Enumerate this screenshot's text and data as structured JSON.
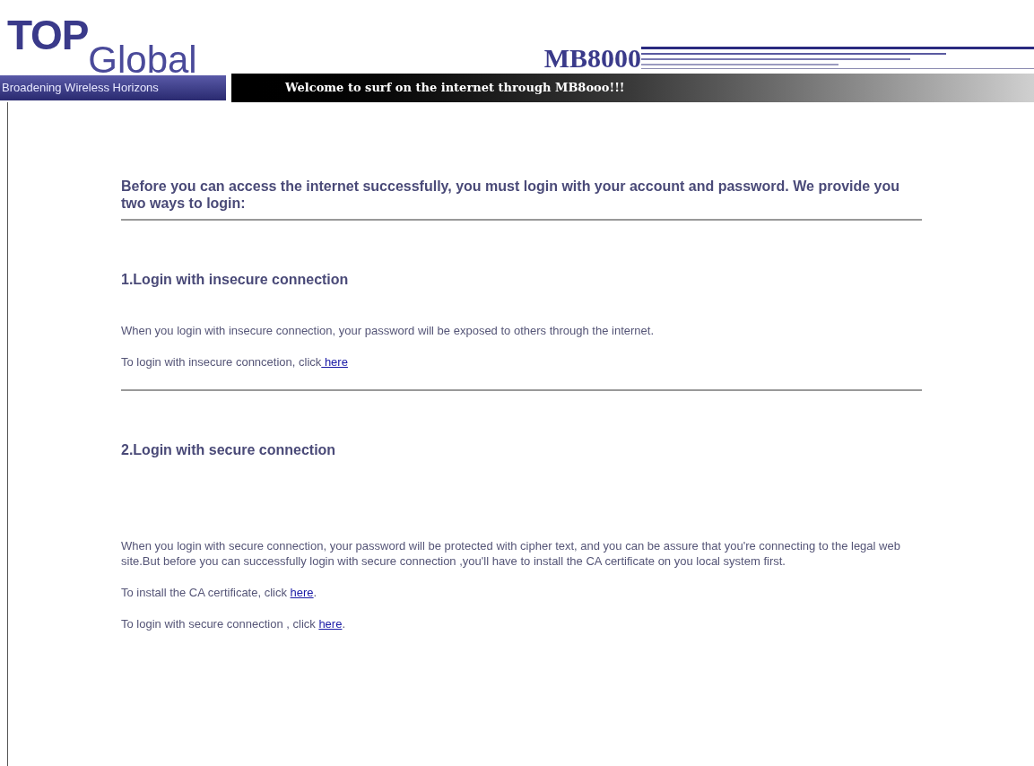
{
  "header": {
    "logo_top": "TOP",
    "logo_global": "Global",
    "tagline": "Broadening Wireless Horizons",
    "welcome": "Welcome to surf on the internet through MB8ooo!!!",
    "model": "MB8000"
  },
  "intro": "Before you can access the internet successfully, you must login with your account and password. We provide you two ways to login:",
  "sections": [
    {
      "title": "1.Login with insecure connection",
      "paragraphs": [
        {
          "text": "When you login with insecure connection, your password will be exposed to others through the internet."
        },
        {
          "text": "To login with insecure conncetion, click",
          "link": " here"
        }
      ]
    },
    {
      "title": "2.Login with secure connection",
      "paragraphs": [
        {
          "text": "When you login with secure connection, your password will be protected with cipher text, and you can be assure that you're connecting to the legal web site.But before you can successfully login with secure connection ,you'll have to install the CA certificate on you local system first."
        },
        {
          "text": "To install the CA certificate, click ",
          "link": "here",
          "after": "."
        },
        {
          "text": "To login with secure connection , click ",
          "link": "here",
          "after": "."
        }
      ]
    }
  ]
}
